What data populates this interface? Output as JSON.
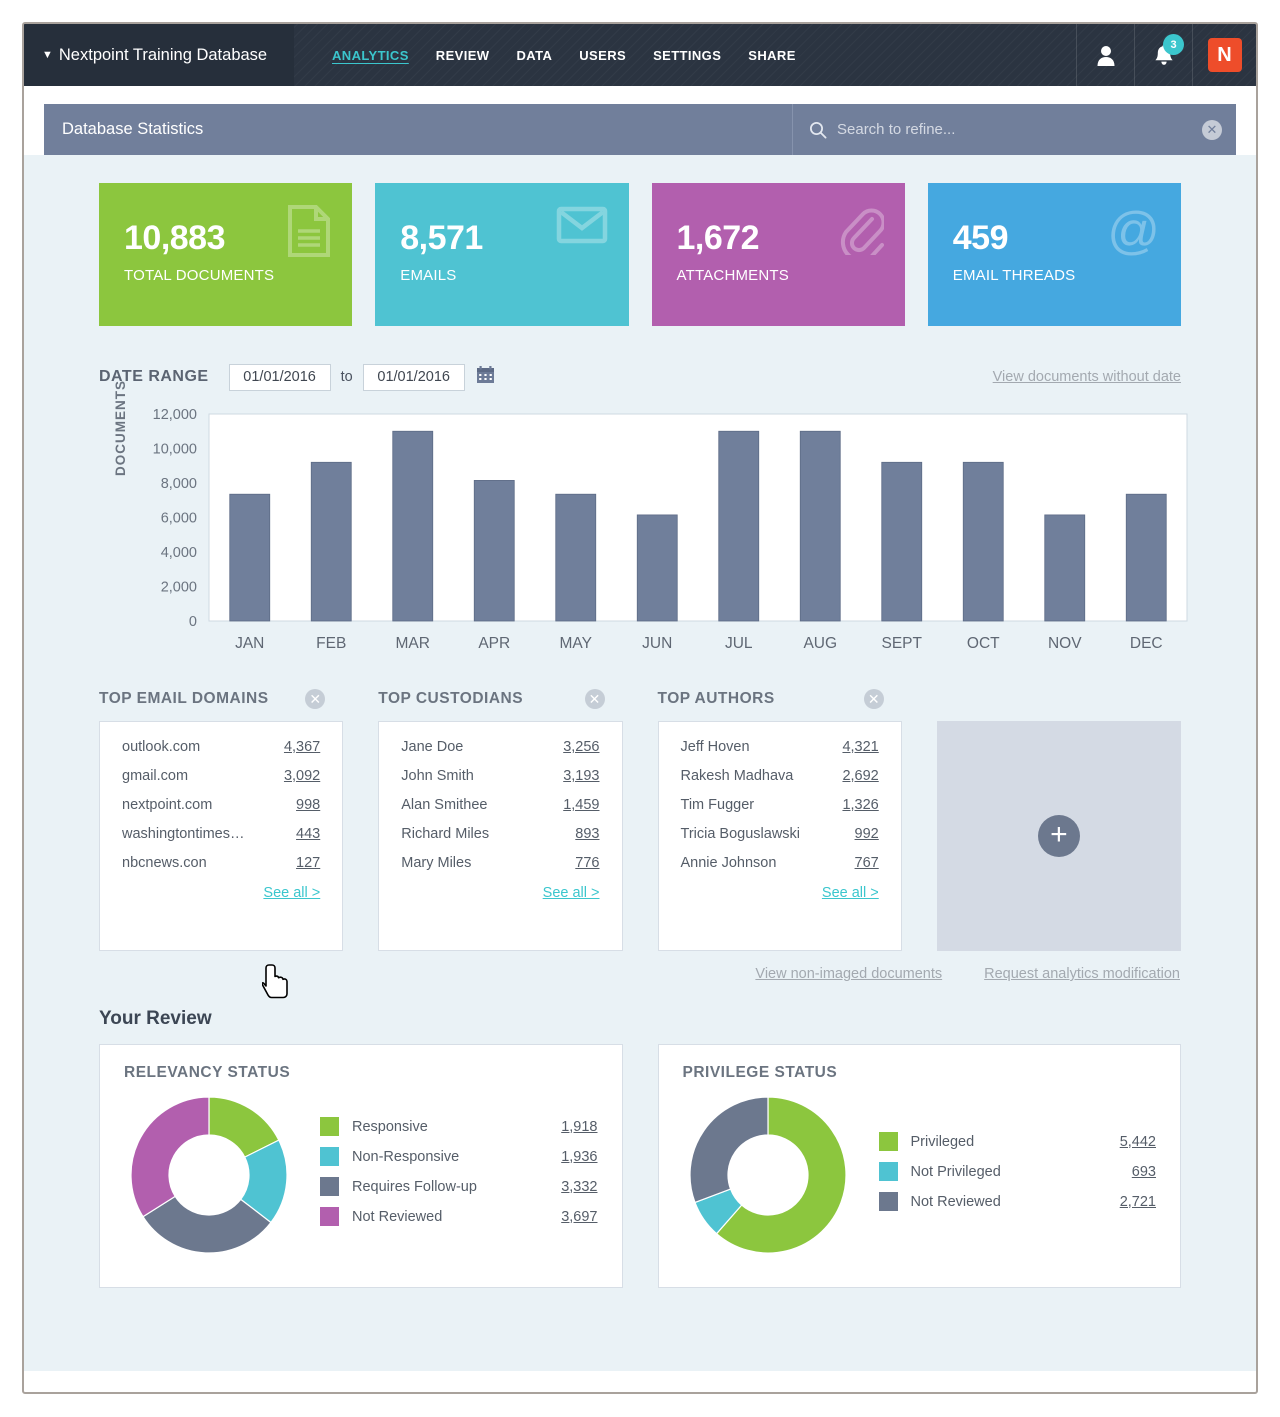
{
  "topbar": {
    "database_name": "Nextpoint Training Database",
    "caret": "▼",
    "nav": [
      {
        "label": "ANALYTICS",
        "active": true
      },
      {
        "label": "REVIEW",
        "active": false
      },
      {
        "label": "DATA",
        "active": false
      },
      {
        "label": "USERS",
        "active": false
      },
      {
        "label": "SETTINGS",
        "active": false
      },
      {
        "label": "SHARE",
        "active": false
      }
    ],
    "user_icon": "person-icon",
    "notification_icon": "bell-icon",
    "notification_count": "3",
    "logo_text": "N",
    "logo_color": "#ee4d2a"
  },
  "titlebar": {
    "title": "Database Statistics",
    "search_placeholder": "Search to refine...",
    "search_value": "",
    "clear_glyph": "✕"
  },
  "cards": [
    {
      "value": "10,883",
      "label": "TOTAL DOCUMENTS",
      "color": "#8cc63e",
      "icon": "document-icon"
    },
    {
      "value": "8,571",
      "label": "EMAILS",
      "color": "#4fc3d2",
      "icon": "envelope-icon"
    },
    {
      "value": "1,672",
      "label": "ATTACHMENTS",
      "color": "#b25fae",
      "icon": "paperclip-icon"
    },
    {
      "value": "459",
      "label": "EMAIL THREADS",
      "color": "#45a8e0",
      "icon": "at-icon"
    }
  ],
  "date_range": {
    "label": "DATE RANGE",
    "from": "01/01/2016",
    "to_word": "to",
    "to": "01/01/2016",
    "calendar_icon": "calendar-icon",
    "no_date_link": "View documents without date"
  },
  "chart_data": {
    "type": "bar",
    "title": "",
    "xlabel": "",
    "ylabel": "DOCUMENTS",
    "categories": [
      "JAN",
      "FEB",
      "MAR",
      "APR",
      "MAY",
      "JUN",
      "JUL",
      "AUG",
      "SEPT",
      "OCT",
      "NOV",
      "DEC"
    ],
    "values": [
      7350,
      9200,
      11000,
      8150,
      7350,
      6150,
      11000,
      11000,
      9200,
      9200,
      6150,
      7350
    ],
    "ylim": [
      0,
      12000
    ],
    "yticks": [
      0,
      2000,
      4000,
      6000,
      8000,
      10000,
      12000
    ],
    "ytick_labels": [
      "0",
      "2,000",
      "4,000",
      "6,000",
      "8,000",
      "10,000",
      "12,000"
    ],
    "grid": false,
    "bar_color": "#707f9b",
    "legend": "none"
  },
  "lists": [
    {
      "title": "TOP EMAIL DOMAINS",
      "close_icon": "close-icon",
      "rows": [
        {
          "name": "outlook.com",
          "value": "4,367"
        },
        {
          "name": "gmail.com",
          "value": "3,092"
        },
        {
          "name": "nextpoint.com",
          "value": "998"
        },
        {
          "name": "washingtontimes…",
          "value": "443"
        },
        {
          "name": "nbcnews.con",
          "value": "127"
        }
      ],
      "see_all": "See all >"
    },
    {
      "title": "TOP CUSTODIANS",
      "close_icon": "close-icon",
      "rows": [
        {
          "name": "Jane Doe",
          "value": "3,256"
        },
        {
          "name": "John Smith",
          "value": "3,193"
        },
        {
          "name": "Alan Smithee",
          "value": "1,459"
        },
        {
          "name": "Richard Miles",
          "value": "893"
        },
        {
          "name": "Mary Miles",
          "value": "776"
        }
      ],
      "see_all": "See all >"
    },
    {
      "title": "TOP AUTHORS",
      "close_icon": "close-icon",
      "rows": [
        {
          "name": "Jeff Hoven",
          "value": "4,321"
        },
        {
          "name": "Rakesh Madhava",
          "value": "2,692"
        },
        {
          "name": "Tim Fugger",
          "value": "1,326"
        },
        {
          "name": "Tricia Boguslawski",
          "value": "992"
        },
        {
          "name": "Annie Johnson",
          "value": "767"
        }
      ],
      "see_all": "See all >"
    }
  ],
  "add_panel": {
    "icon": "plus-icon"
  },
  "below_links": [
    "View non-imaged documents",
    "Request analytics modification"
  ],
  "your_review": {
    "heading": "Your Review",
    "relevancy": {
      "title": "RELEVANCY STATUS",
      "chart_data": {
        "type": "pie",
        "title": "RELEVANCY STATUS",
        "labels": [
          "Responsive",
          "Non-Responsive",
          "Requires Follow-up",
          "Not Reviewed"
        ],
        "values": [
          1918,
          1936,
          3332,
          3697
        ],
        "colors": [
          "#8cc63e",
          "#4fc3d2",
          "#6c788e",
          "#b25fae"
        ],
        "legend": "right",
        "donut": true
      },
      "legend": [
        {
          "name": "Responsive",
          "value": "1,918",
          "color": "#8cc63e"
        },
        {
          "name": "Non-Responsive",
          "value": "1,936",
          "color": "#4fc3d2"
        },
        {
          "name": "Requires Follow-up",
          "value": "3,332",
          "color": "#6c788e"
        },
        {
          "name": "Not Reviewed",
          "value": "3,697",
          "color": "#b25fae"
        }
      ]
    },
    "privilege": {
      "title": "PRIVILEGE STATUS",
      "chart_data": {
        "type": "pie",
        "title": "PRIVILEGE STATUS",
        "labels": [
          "Privileged",
          "Not Privileged",
          "Not Reviewed"
        ],
        "values": [
          5442,
          693,
          2721
        ],
        "colors": [
          "#8cc63e",
          "#4fc3d2",
          "#6c788e"
        ],
        "legend": "right",
        "donut": true
      },
      "legend": [
        {
          "name": "Privileged",
          "value": "5,442",
          "color": "#8cc63e"
        },
        {
          "name": "Not Privileged",
          "value": "693",
          "color": "#4fc3d2"
        },
        {
          "name": "Not Reviewed",
          "value": "2,721",
          "color": "#6c788e"
        }
      ]
    }
  }
}
